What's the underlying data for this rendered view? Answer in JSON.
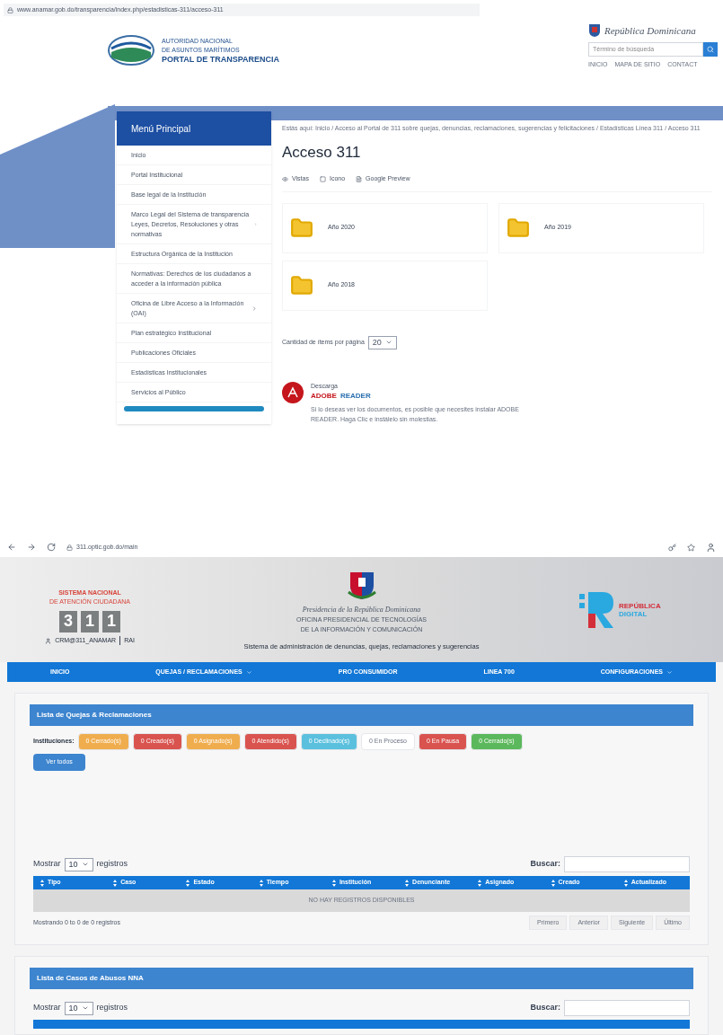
{
  "portal_browser": {
    "url": "www.anamar.gob.do/transparencia/index.php/estadisticas-311/acceso-311"
  },
  "portal": {
    "logo_lines": [
      "AUTORIDAD NACIONAL",
      "DE ASUNTOS MARÍTIMOS",
      "PORTAL DE TRANSPARENCIA"
    ],
    "gov": "República Dominicana",
    "search_placeholder": "Término de búsqueda",
    "links": [
      "INICIO",
      "MAPA DE SITIO",
      "CONTACT"
    ],
    "menu_title": "Menú Principal",
    "menu_items": [
      {
        "label": "Inicio",
        "expandable": false
      },
      {
        "label": "Portal Institucional",
        "expandable": false
      },
      {
        "label": "Base legal de la Institución",
        "expandable": false
      },
      {
        "label": "Marco Legal del Sistema de transparencia Leyes, Decretos, Resoluciones y otras normativas",
        "expandable": true
      },
      {
        "label": "Estructura Orgánica de la Institución",
        "expandable": false
      },
      {
        "label": "Normativas: Derechos de los ciudadanos a acceder a la información pública",
        "expandable": false
      },
      {
        "label": "Oficina de Libre Acceso a la Información (OAI)",
        "expandable": true
      },
      {
        "label": "Plan estratégico Institucional",
        "expandable": false
      },
      {
        "label": "Publicaciones Oficiales",
        "expandable": false
      },
      {
        "label": "Estadísticas Institucionales",
        "expandable": false
      },
      {
        "label": "Servicios al Público",
        "expandable": false
      }
    ],
    "breadcrumb": "Estás aquí: Inicio / Acceso al Portal de 311 sobre quejas, denuncias, reclamaciones, sugerencias y felicitaciones / Estadísticas Línea 311 / Acceso 311",
    "title": "Acceso 311",
    "view_options": [
      "Vistas",
      "Icono",
      "Google Preview"
    ],
    "folders": [
      "Año 2020",
      "Año 2019",
      "Año 2018"
    ],
    "per_page_label": "Cantidad de ítems por página",
    "per_page": "20",
    "adobe": {
      "small": "Descarga",
      "brand_a": "ADOBE",
      "brand_b": "READER",
      "note": "Si lo deseas ver los documentos, es posible que necesites instalar ADOBE READER. Haga Clic e instálelo sin molestias."
    }
  },
  "crm_browser": {
    "url": "311.optic.gob.do/main"
  },
  "crm_header": {
    "system_lines": [
      "SISTEMA NACIONAL",
      "DE ATENCIÓN CIUDADANA"
    ],
    "digits": [
      "3",
      "1",
      "1"
    ],
    "user": "CRM@311_ANAMAR",
    "role": "RAI",
    "presidency": "Presidencia de la República Dominicana",
    "office_lines": [
      "OFICINA PRESIDENCIAL DE TECNOLOGÍAS",
      "DE LA INFORMACIÓN Y COMUNICACIÓN"
    ],
    "subtitle": "Sistema de administración de denuncias, quejas, reclamaciones y sugerencias",
    "brand_lines": [
      "REPÚBLICA",
      "DIGITAL"
    ]
  },
  "nav": [
    {
      "label": "INICIO",
      "dropdown": false
    },
    {
      "label": "QUEJAS / RECLAMACIONES",
      "dropdown": true
    },
    {
      "label": "PRO CONSUMIDOR",
      "dropdown": false
    },
    {
      "label": "LINEA 700",
      "dropdown": false
    },
    {
      "label": "CONFIGURACIONES",
      "dropdown": true
    }
  ],
  "complaints_panel": {
    "title": "Lista de Quejas & Reclamaciones",
    "filter_label": "Instituciones:",
    "filters": [
      {
        "label": "0 Cerrado(s)",
        "color": "#f0ad4e"
      },
      {
        "label": "0 Creado(s)",
        "color": "#d9534f"
      },
      {
        "label": "0 Asignado(s)",
        "color": "#f0ad4e"
      },
      {
        "label": "0 Atendido(s)",
        "color": "#d9534f"
      },
      {
        "label": "0 Declinado(s)",
        "color": "#5bc0de"
      },
      {
        "label": "0 En Proceso",
        "color": "#ffffff"
      },
      {
        "label": "0 En Pausa",
        "color": "#d9534f"
      },
      {
        "label": "0 Cerrado(s)",
        "color": "#5cb85c"
      }
    ],
    "view_all": "Ver todos",
    "show_label": "Mostrar",
    "show_value": "10",
    "records_label": "registros",
    "search_label": "Buscar:",
    "columns": [
      "Tipo",
      "Caso",
      "Estado",
      "Tiempo",
      "Institución",
      "Denunciante",
      "Asignado",
      "Creado",
      "Actualizado"
    ],
    "empty": "NO HAY REGISTROS DISPONIBLES",
    "info": "Mostrando 0 to 0 de 0 registros",
    "pages": [
      "Primero",
      "Anterior",
      "Siguiente",
      "Último"
    ]
  },
  "abuse_panel": {
    "title": "Lista de Casos de Abusos NNA",
    "show_label": "Mostrar",
    "show_value": "10",
    "records_label": "registros",
    "search_label": "Buscar:"
  }
}
